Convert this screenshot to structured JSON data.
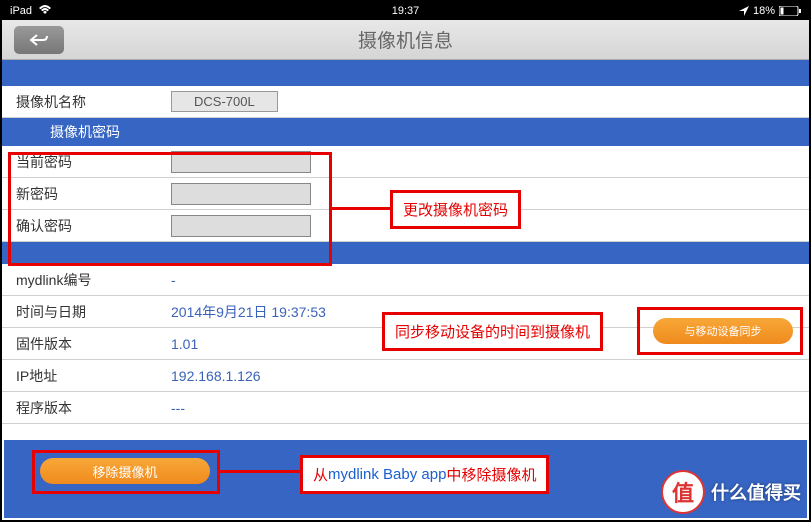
{
  "status": {
    "device": "iPad",
    "time": "19:37",
    "battery": "18%"
  },
  "nav": {
    "title": "摄像机信息"
  },
  "fields": {
    "camera_name_label": "摄像机名称",
    "camera_model": "DCS-700L",
    "password_section": "摄像机密码",
    "current_pwd": "当前密码",
    "new_pwd": "新密码",
    "confirm_pwd": "确认密码",
    "mydlink_label": "mydlink编号",
    "mydlink_value": "-",
    "datetime_label": "时间与日期",
    "datetime_value": "2014年9月21日 19:37:53",
    "firmware_label": "固件版本",
    "firmware_value": "1.01",
    "ip_label": "IP地址",
    "ip_value": "192.168.1.126",
    "program_label": "程序版本",
    "program_value": "---"
  },
  "buttons": {
    "sync": "与移动设备同步",
    "remove": "移除摄像机"
  },
  "callouts": {
    "c1": "更改摄像机密码",
    "c2": "同步移动设备的时间到摄像机",
    "c3_prefix": "从 ",
    "c3_app": "mydlink Baby app ",
    "c3_mid": "中 ",
    "c3_suffix": "移除摄像机"
  },
  "watermark": {
    "badge": "值",
    "text": "什么值得买"
  }
}
